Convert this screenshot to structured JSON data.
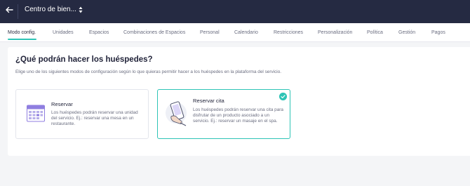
{
  "app": {
    "title": "Centro de bien...",
    "icons": {
      "back": "arrow-left-icon",
      "sort": "sort-arrows-icon"
    }
  },
  "tabs": [
    {
      "label": "Modo config.",
      "active": true
    },
    {
      "label": "Unidades",
      "active": false
    },
    {
      "label": "Espacios",
      "active": false
    },
    {
      "label": "Combinaciones de Espacios",
      "active": false
    },
    {
      "label": "Personal",
      "active": false
    },
    {
      "label": "Calendario",
      "active": false
    },
    {
      "label": "Restricciones",
      "active": false
    },
    {
      "label": "Personalización",
      "active": false
    },
    {
      "label": "Política",
      "active": false
    },
    {
      "label": "Gestión",
      "active": false
    },
    {
      "label": "Pagos",
      "active": false
    }
  ],
  "page": {
    "heading": "¿Qué podrán hacer los huéspedes?",
    "subtext": "Elige uno de los siguientes modos de configuración según lo que quieras permitir hacer a los huéspedes en la plataforma del servicio."
  },
  "options": [
    {
      "title": "Reservar",
      "description": "Los huéspedes podrán reservar una unidad del servicio. Ej.: reservar una mesa en un restaurante.",
      "icon": "calendar-icon",
      "selected": false
    },
    {
      "title": "Reservar cita",
      "description": "Los huéspedes podrán reservar una cita para disfrutar de un producto asociado a un servicio. Ej.: reservar un masaje en el spa.",
      "icon": "phone-in-hand-icon",
      "selected": true
    }
  ],
  "colors": {
    "topbar": "#252a42",
    "accent": "#2ec4b6",
    "calendar_accent": "#8f7ee0"
  }
}
